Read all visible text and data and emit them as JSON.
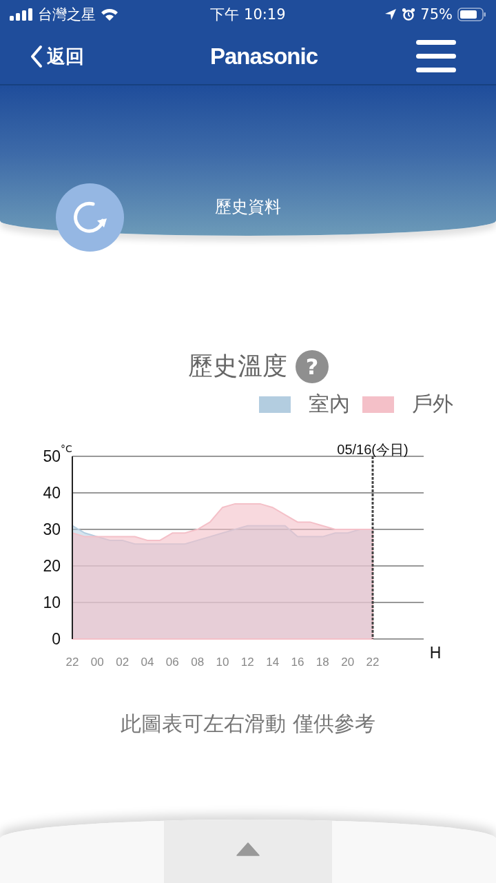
{
  "status_bar": {
    "carrier": "台灣之星",
    "time": "下午 10:19",
    "battery": "75%"
  },
  "header": {
    "back": "返回",
    "logo": "Panasonic"
  },
  "banner": {
    "title": "歷史資料"
  },
  "history": {
    "title": "歷史溫度",
    "help": "?",
    "chart_data": {
      "type": "area",
      "xlabel": "H",
      "ylabel": "°C",
      "categories": [
        "22",
        null,
        "00",
        null,
        "02",
        null,
        "04",
        null,
        "06",
        null,
        "08",
        null,
        "10",
        null,
        "12",
        null,
        "14",
        null,
        "16",
        null,
        "18",
        null,
        "20",
        null,
        "22"
      ],
      "series": [
        {
          "name": "室內",
          "color": "#b3cde0",
          "values": [
            31,
            29,
            28,
            27,
            27,
            26,
            26,
            26,
            26,
            26,
            27,
            28,
            29,
            30,
            31,
            31,
            31,
            31,
            28,
            28,
            28,
            29,
            29,
            30,
            30
          ]
        },
        {
          "name": "戶外",
          "color": "#f4c0c8",
          "values": [
            29,
            28,
            28,
            28,
            28,
            28,
            27,
            27,
            29,
            29,
            30,
            32,
            36,
            37,
            37,
            37,
            36,
            34,
            32,
            32,
            31,
            30,
            30,
            30,
            30
          ]
        }
      ],
      "ylim": [
        0,
        50
      ],
      "yticks": [
        0,
        10,
        20,
        30,
        40,
        50
      ],
      "grid": true,
      "annotations": [
        "05/16(今日)"
      ]
    },
    "note": "此圖表可左右滑動 僅供參考"
  }
}
